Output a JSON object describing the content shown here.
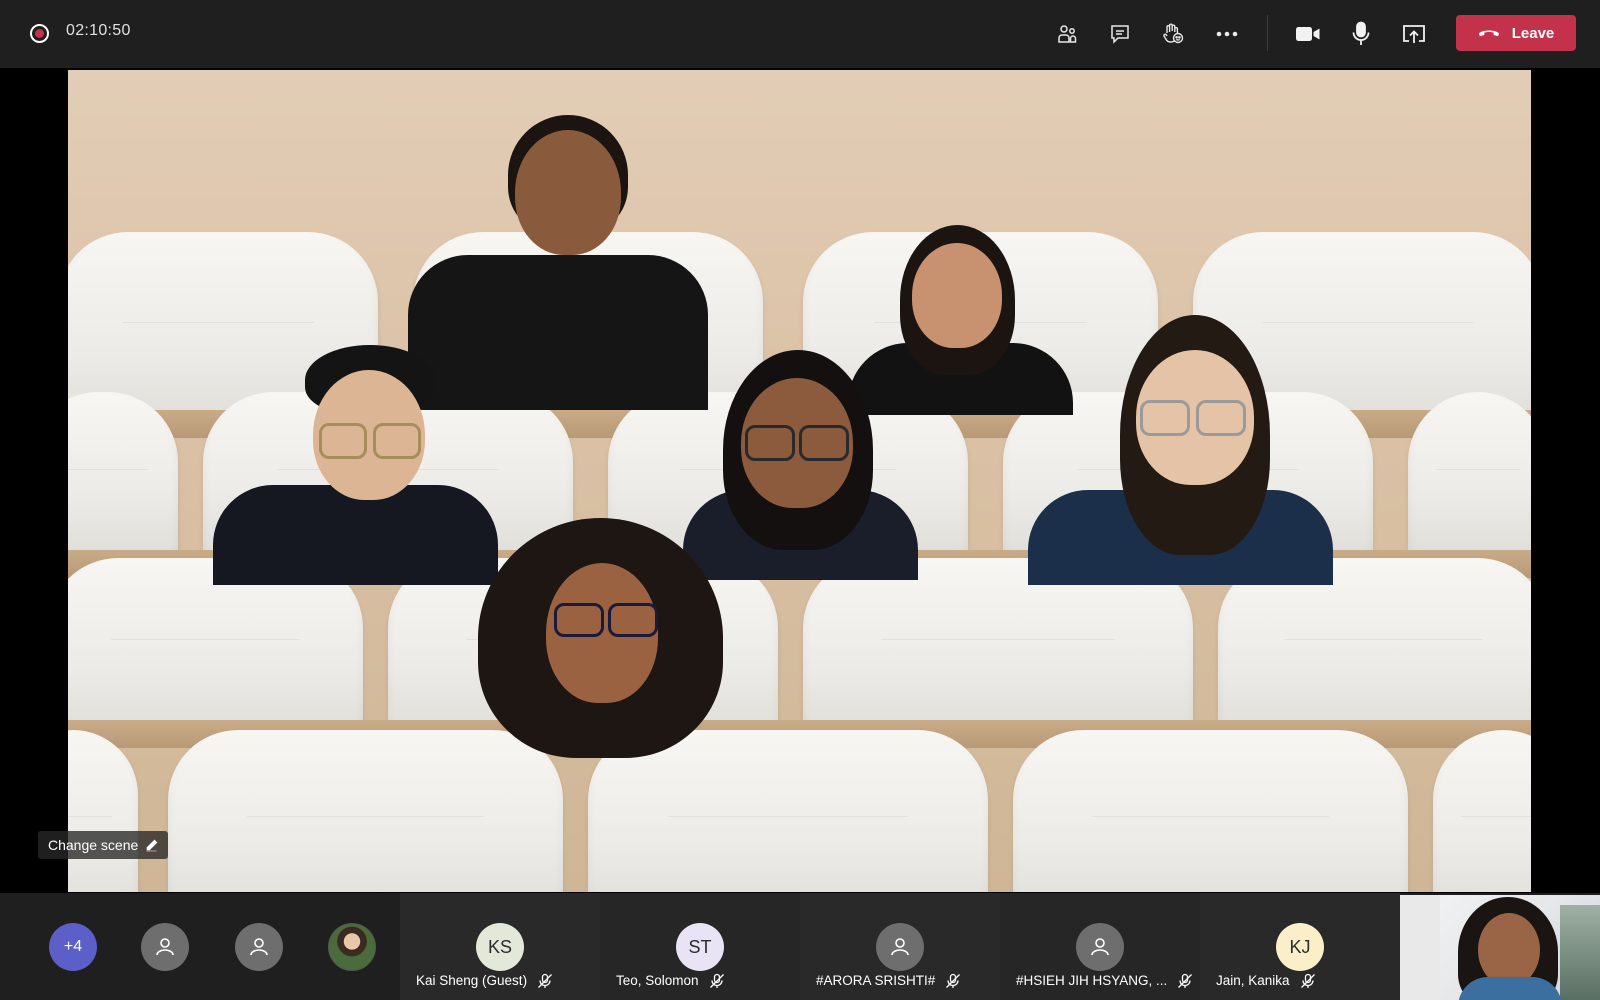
{
  "meeting": {
    "timer": "02:10:50",
    "leave_label": "Leave"
  },
  "toolbar": {
    "icons": [
      "people-icon",
      "chat-icon",
      "raise-hand-icon",
      "more-options-icon",
      "camera-icon",
      "microphone-icon",
      "share-screen-icon"
    ]
  },
  "stage": {
    "change_scene_label": "Change scene"
  },
  "gallery": {
    "overflow_count": "+4",
    "participants": [
      {
        "initials": "KS",
        "name": "Kai Sheng (Guest)",
        "avatar_color": "#e3e9d9",
        "muted": true
      },
      {
        "initials": "ST",
        "name": "Teo, Solomon",
        "avatar_color": "#e8e4f6",
        "muted": true
      },
      {
        "initials": "",
        "name": "#ARORA SRISHTI#",
        "avatar_color": "#6e6e6e",
        "muted": true
      },
      {
        "initials": "",
        "name": "#HSIEH JIH HSYANG, ...",
        "avatar_color": "#6e6e6e",
        "muted": true
      },
      {
        "initials": "KJ",
        "name": "Jain, Kanika",
        "avatar_color": "#fbefc9",
        "muted": true
      }
    ]
  },
  "colors": {
    "leave_red": "#c4314b",
    "overflow_badge": "#5b5fc7",
    "toolbar_bg": "#1f1f1f"
  }
}
